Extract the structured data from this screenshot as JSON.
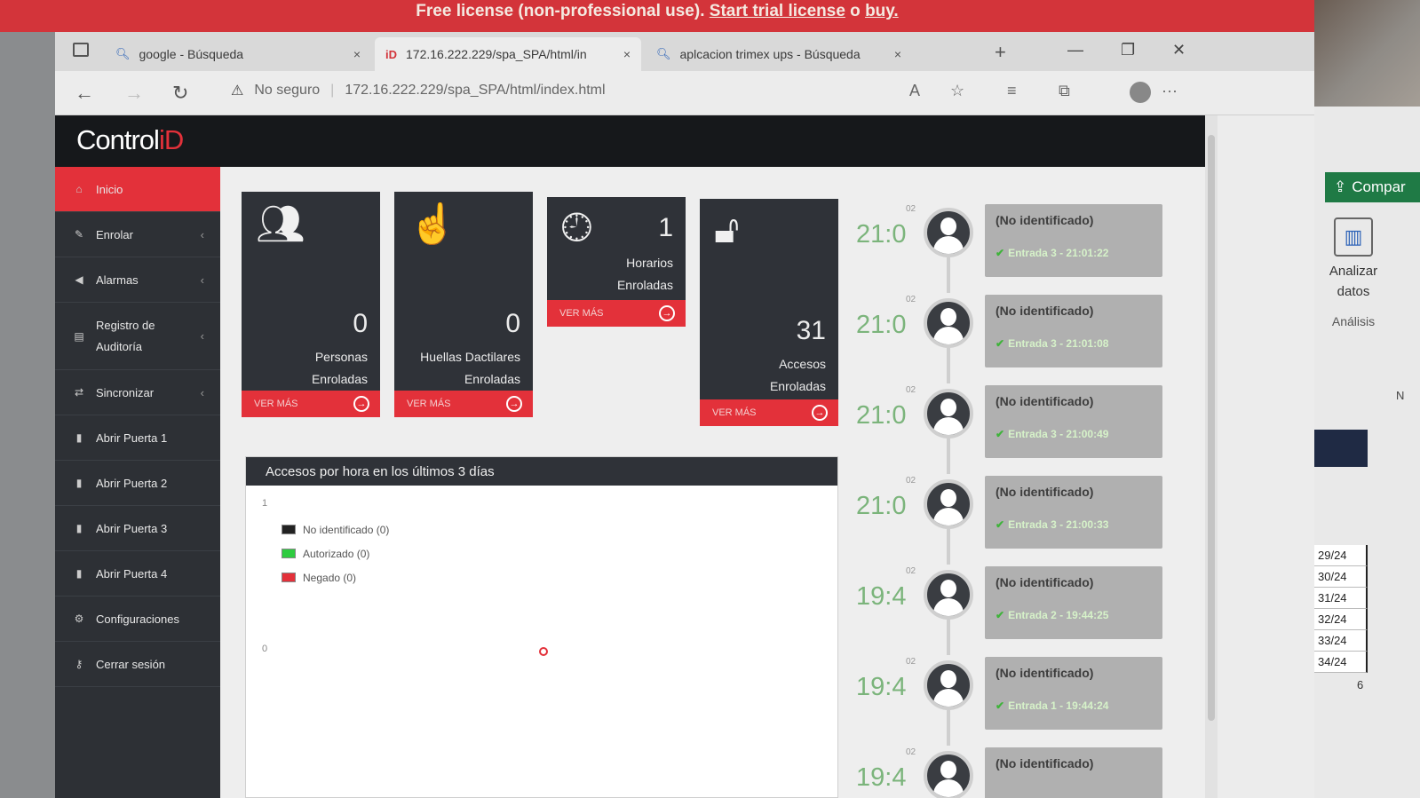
{
  "banner": {
    "text": "Free license (non-professional use).",
    "trial_link": "Start trial license",
    "or": "o",
    "buy_link": "buy."
  },
  "tabs": [
    {
      "title": "google - Búsqueda",
      "close": "×"
    },
    {
      "title": "172.16.222.229/spa_SPA/html/in",
      "close": "×"
    },
    {
      "title": "aplcacion trimex ups - Búsqueda",
      "close": "×"
    }
  ],
  "new_tab": "+",
  "window_controls": {
    "minimize": "—",
    "restore": "❐",
    "close": "✕"
  },
  "address": {
    "security": "No seguro",
    "url": "172.16.222.229/spa_SPA/html/index.html"
  },
  "app": {
    "logo_text": "Control",
    "logo_accent": "iD"
  },
  "sidebar": {
    "items": [
      {
        "label": "Inicio",
        "icon": "home-icon"
      },
      {
        "label": "Enrolar",
        "icon": "edit-icon"
      },
      {
        "label": "Alarmas",
        "icon": "bullhorn-icon"
      },
      {
        "label": "Registro de Auditoría",
        "icon": "chart-icon"
      },
      {
        "label": "Sincronizar",
        "icon": "shuffle-icon"
      },
      {
        "label": "Abrir Puerta 1",
        "icon": "door-icon"
      },
      {
        "label": "Abrir Puerta 2",
        "icon": "door-icon"
      },
      {
        "label": "Abrir Puerta 3",
        "icon": "door-icon"
      },
      {
        "label": "Abrir Puerta 4",
        "icon": "door-icon"
      },
      {
        "label": "Configuraciones",
        "icon": "gears-icon"
      },
      {
        "label": "Cerrar sesión",
        "icon": "key-icon"
      }
    ],
    "chevron": "‹"
  },
  "cards": [
    {
      "value": "0",
      "label_1": "Personas",
      "label_2": "Enroladas",
      "more": "VER MÁS",
      "icon": "users-icon"
    },
    {
      "value": "0",
      "label_1": "Huellas Dactilares",
      "label_2": "Enroladas",
      "more": "VER MÁS",
      "icon": "hand-pointer-icon"
    },
    {
      "value": "1",
      "label_1": "Horarios",
      "label_2": "Enroladas",
      "more": "VER MÁS",
      "icon": "clock-icon"
    },
    {
      "value": "31",
      "label_1": "Accesos",
      "label_2": "Enroladas",
      "more": "VER MÁS",
      "icon": "unlock-icon"
    }
  ],
  "chart": {
    "title": "Accesos por hora en los últimos 3 días",
    "y_ticks": [
      "1",
      "0"
    ],
    "legend": [
      {
        "label": "No identificado (0)",
        "color": "#222222"
      },
      {
        "label": "Autorizado (0)",
        "color": "#2ecc40"
      },
      {
        "label": "Negado (0)",
        "color": "#e3313a"
      }
    ]
  },
  "feed": [
    {
      "time": "21:0",
      "date": "02",
      "name": "(No identificado)",
      "status": "Entrada 3 - 21:01:22"
    },
    {
      "time": "21:0",
      "date": "02",
      "name": "(No identificado)",
      "status": "Entrada 3 - 21:01:08"
    },
    {
      "time": "21:0",
      "date": "02",
      "name": "(No identificado)",
      "status": "Entrada 3 - 21:00:49"
    },
    {
      "time": "21:0",
      "date": "02",
      "name": "(No identificado)",
      "status": "Entrada 3 - 21:00:33"
    },
    {
      "time": "19:4",
      "date": "02",
      "name": "(No identificado)",
      "status": "Entrada 2 - 19:44:25"
    },
    {
      "time": "19:4",
      "date": "02",
      "name": "(No identificado)",
      "status": "Entrada 1 - 19:44:24"
    },
    {
      "time": "19:4",
      "date": "02",
      "name": "(No identificado)",
      "status": ""
    }
  ],
  "excel": {
    "share": "Compar",
    "analyze": "Analizar datos",
    "group": "Análisis",
    "column": "N",
    "cells": [
      "29/24",
      "30/24",
      "31/24",
      "32/24",
      "33/24",
      "34/24"
    ],
    "below": "6"
  }
}
